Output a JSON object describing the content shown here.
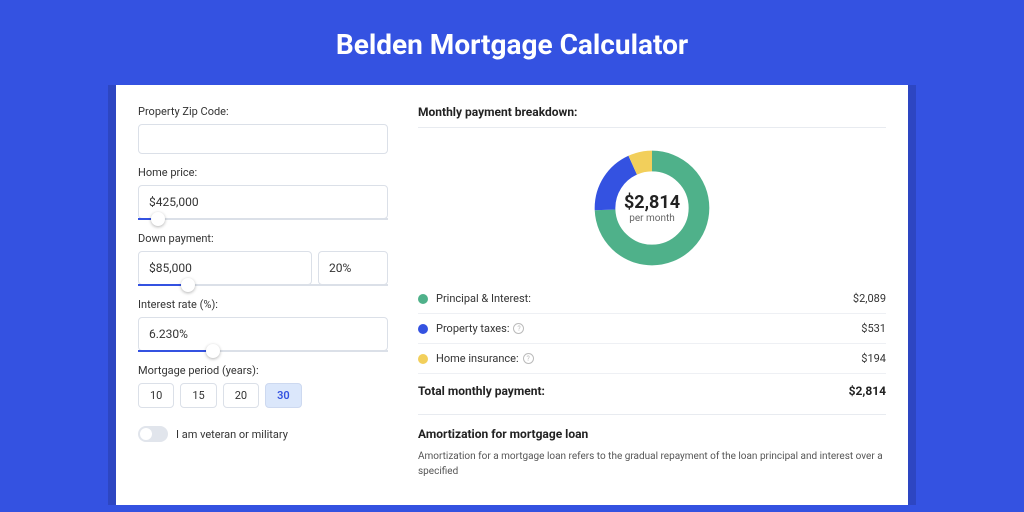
{
  "title": "Belden Mortgage Calculator",
  "form": {
    "zip_label": "Property Zip Code:",
    "zip_value": "",
    "price_label": "Home price:",
    "price_value": "$425,000",
    "price_slider_pct": 8,
    "down_label": "Down payment:",
    "down_amount": "$85,000",
    "down_pct": "20%",
    "down_slider_pct": 20,
    "rate_label": "Interest rate (%):",
    "rate_value": "6.230%",
    "rate_slider_pct": 30,
    "period_label": "Mortgage period (years):",
    "periods": [
      "10",
      "15",
      "20",
      "30"
    ],
    "period_active": 3,
    "veteran_label": "I am veteran or military"
  },
  "breakdown": {
    "title": "Monthly payment breakdown:",
    "donut_amount": "$2,814",
    "donut_sub": "per month",
    "items": [
      {
        "label": "Principal & Interest:",
        "value": "$2,089",
        "color": "#4fb18a",
        "info": false
      },
      {
        "label": "Property taxes:",
        "value": "$531",
        "color": "#3452e1",
        "info": true
      },
      {
        "label": "Home insurance:",
        "value": "$194",
        "color": "#f2cf5b",
        "info": true
      }
    ],
    "total_label": "Total monthly payment:",
    "total_value": "$2,814"
  },
  "amort": {
    "title": "Amortization for mortgage loan",
    "text": "Amortization for a mortgage loan refers to the gradual repayment of the loan principal and interest over a specified"
  },
  "chart_data": {
    "type": "pie",
    "title": "Monthly payment breakdown",
    "series": [
      {
        "name": "Principal & Interest",
        "value": 2089,
        "color": "#4fb18a"
      },
      {
        "name": "Property taxes",
        "value": 531,
        "color": "#3452e1"
      },
      {
        "name": "Home insurance",
        "value": 194,
        "color": "#f2cf5b"
      }
    ],
    "total": 2814,
    "center_label": "$2,814 per month"
  }
}
